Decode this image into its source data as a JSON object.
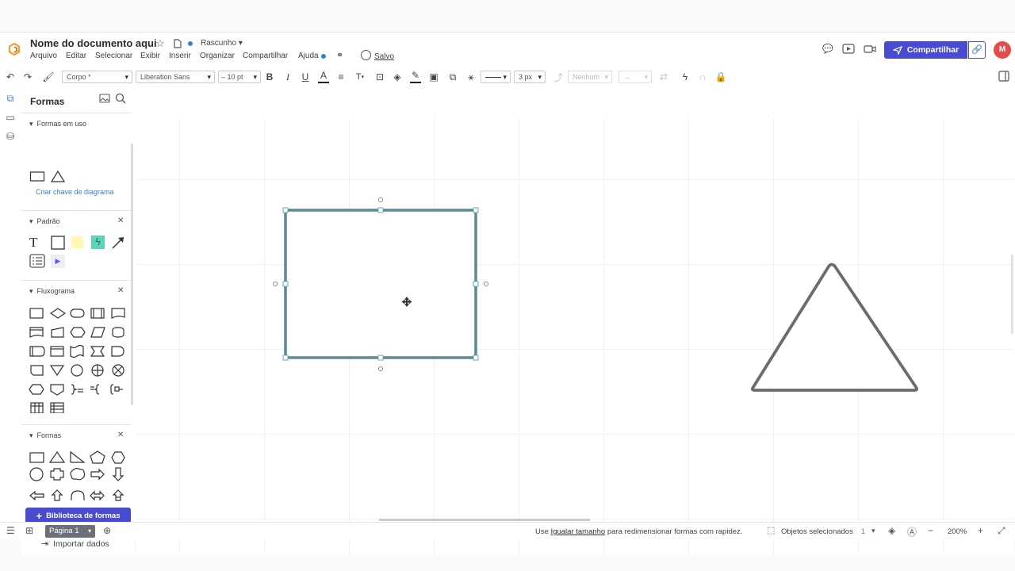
{
  "header": {
    "title": "Nome do documento aqui",
    "status": "Rascunho",
    "menu": [
      "Arquivo",
      "Editar",
      "Selecionar",
      "Exibir",
      "Inserir",
      "Organizar",
      "Compartilhar",
      "Ajuda"
    ],
    "saved": "Salvo",
    "share_label": "Compartilhar",
    "avatar_initial": "M"
  },
  "toolbar": {
    "text_style": "Corpo *",
    "font": "Liberation Sans",
    "font_size": "10 pt",
    "line_width": "3 px",
    "arrow_style": "Nenhum"
  },
  "panel": {
    "title": "Formas",
    "in_use_header": "Formas em uso",
    "diagram_key_link": "Criar chave de diagrama",
    "standard_header": "Padrão",
    "flowchart_header": "Fluxograma",
    "shapes_header": "Formas",
    "library_button": "Biblioteca de formas",
    "import_label": "Importar dados"
  },
  "statusbar": {
    "page_tab": "Página 1",
    "hint_pre": "Use",
    "hint_link": "Igualar tamanho",
    "hint_post": "para redimensionar formas com rapidez.",
    "selected_label": "Objetos selecionados",
    "selected_count": "1",
    "zoom": "200%"
  },
  "colors": {
    "accent": "#4a4ccf",
    "selection": "#5a8a92",
    "link": "#3b82c4",
    "avatar": "#e14d4d"
  }
}
